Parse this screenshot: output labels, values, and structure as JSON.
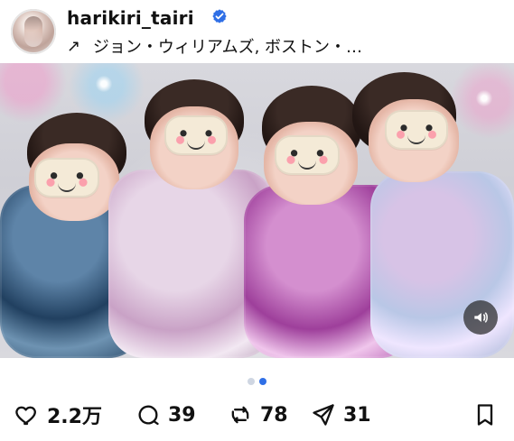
{
  "post": {
    "username": "harikiri_tairi",
    "location": "ジョン・ウィリアムズ, ボストン・…",
    "carousel": {
      "active_index": 2,
      "total": 2
    },
    "actions": {
      "likes": "2.2万",
      "comments": "39",
      "reposts": "78",
      "shares": "31"
    }
  },
  "icons": {
    "verified": "verified-badge-icon",
    "location_arrow": "north-east-arrow-icon",
    "sound": "speaker-icon",
    "like": "heart-icon",
    "comment": "comment-bubble-icon",
    "repost": "repost-icon",
    "share": "send-icon",
    "save": "bookmark-icon"
  },
  "colors": {
    "verified_blue": "#2f6fe6",
    "pager_active": "#2f6fe6",
    "pager_inactive": "#cfd6e2"
  }
}
